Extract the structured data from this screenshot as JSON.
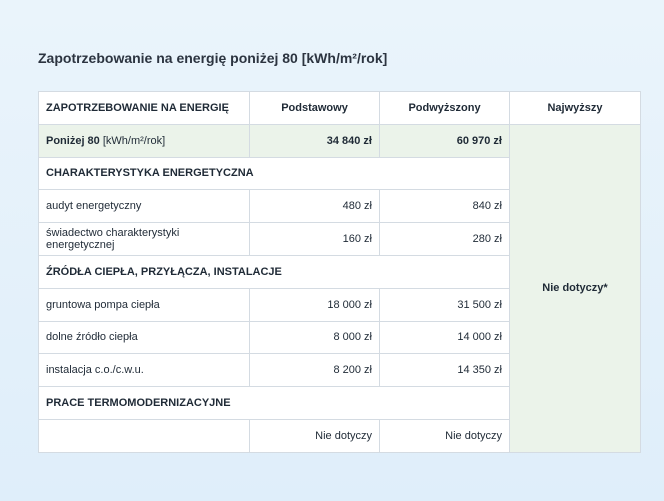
{
  "page_title": "Zapotrzebowanie na energię poniżej 80 [kWh/m²/rok]",
  "header": {
    "col1": "ZAPOTRZEBOWANIE NA ENERGIĘ",
    "col2": "Podstawowy",
    "col3": "Podwyższony",
    "col4": "Najwyższy"
  },
  "highlight_row": {
    "label": "Poniżej 80",
    "unit": "[kWh/m²/rok]",
    "podstawowy": "34 840 zł",
    "podwyzszony": "60 970 zł",
    "najwyzszy": "Nie dotyczy*"
  },
  "sections": {
    "s1": "CHARAKTERYSTYKA ENERGETYCZNA",
    "s2": "ŹRÓDŁA CIEPŁA, PRZYŁĄCZA, INSTALACJE",
    "s3": "PRACE TERMOMODERNIZACYJNE"
  },
  "rows": {
    "audyt": {
      "label": "audyt energetyczny",
      "podstawowy": "480 zł",
      "podwyzszony": "840 zł"
    },
    "swiadectwo": {
      "label": "świadectwo charakterystyki energetycznej",
      "podstawowy": "160 zł",
      "podwyzszony": "280 zł"
    },
    "pompa": {
      "label": "gruntowa pompa ciepła",
      "podstawowy": "18 000 zł",
      "podwyzszony": "31 500 zł"
    },
    "zrodlo": {
      "label": "dolne źródło ciepła",
      "podstawowy": "8 000 zł",
      "podwyzszony": "14 000 zł"
    },
    "instalacja": {
      "label": "instalacja c.o./c.w.u.",
      "podstawowy": "8 200 zł",
      "podwyzszony": "14 350 zł"
    },
    "termo": {
      "label": "",
      "podstawowy": "Nie dotyczy",
      "podwyzszony": "Nie dotyczy"
    }
  }
}
